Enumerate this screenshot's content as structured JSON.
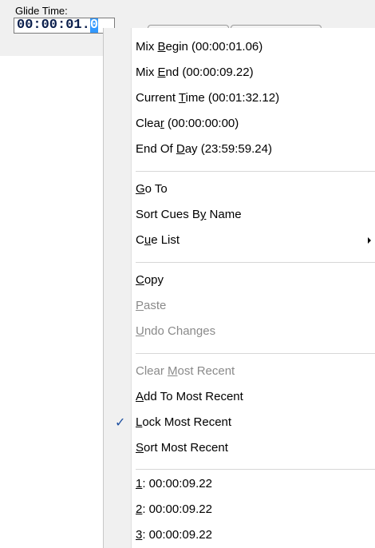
{
  "glide": {
    "label": "Glide Time:",
    "value_prefix": "00:00:01.",
    "value_selected": "0"
  },
  "menu": {
    "items": [
      {
        "pre": "Mix ",
        "key": "B",
        "post": "egin (00:00:01.06)"
      },
      {
        "pre": "Mix ",
        "key": "E",
        "post": "nd (00:00:09.22)"
      },
      {
        "pre": "Current ",
        "key": "T",
        "post": "ime (00:01:32.12)"
      },
      {
        "pre": "Clea",
        "key": "r",
        "post": " (00:00:00:00)"
      },
      {
        "pre": "End Of ",
        "key": "D",
        "post": "ay (23:59:59.24)"
      },
      {
        "pre": "",
        "key": "G",
        "post": "o To"
      },
      {
        "pre": "Sort Cues B",
        "key": "y",
        "post": " Name"
      },
      {
        "pre": "C",
        "key": "u",
        "post": "e List"
      },
      {
        "pre": "",
        "key": "C",
        "post": "opy"
      },
      {
        "pre": "",
        "key": "P",
        "post": "aste",
        "disabled": true
      },
      {
        "pre": "",
        "key": "U",
        "post": "ndo Changes",
        "disabled": true
      },
      {
        "pre": "Clear ",
        "key": "M",
        "post": "ost Recent",
        "disabled": true
      },
      {
        "pre": "",
        "key": "A",
        "post": "dd To Most Recent"
      },
      {
        "pre": "",
        "key": "L",
        "post": "ock Most Recent",
        "checked": true
      },
      {
        "pre": "",
        "key": "S",
        "post": "ort Most Recent"
      },
      {
        "pre": "",
        "key": "1",
        "post": ": 00:00:09.22"
      },
      {
        "pre": "",
        "key": "2",
        "post": ": 00:00:09.22"
      },
      {
        "pre": "",
        "key": "3",
        "post": ": 00:00:09.22"
      }
    ],
    "check_icon": "checkmark-icon",
    "submenu_icon": "submenu-arrow-icon"
  }
}
